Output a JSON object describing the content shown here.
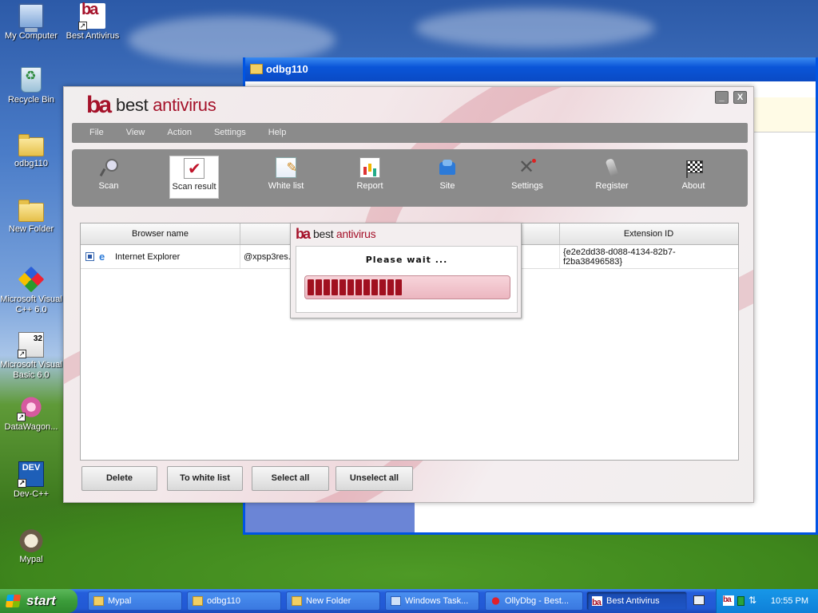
{
  "desktop": {
    "icons": [
      {
        "label": "My Computer"
      },
      {
        "label": "Best Antivirus"
      },
      {
        "label": "Recycle Bin"
      },
      {
        "label": "odbg110"
      },
      {
        "label": "New Folder"
      },
      {
        "label": "Microsoft Visual C++ 6.0"
      },
      {
        "label": "Microsoft Visual Basic 6.0"
      },
      {
        "label": "DataWagon..."
      },
      {
        "label": "Dev-C++"
      },
      {
        "label": "Mypal"
      }
    ]
  },
  "bg_window": {
    "title": "odbg110"
  },
  "app": {
    "logo_mark": "ba",
    "logo_word1": "best",
    "logo_word2": " antivirus",
    "minimize": "_",
    "close": "X",
    "menu": [
      "File",
      "View",
      "Action",
      "Settings",
      "Help"
    ],
    "toolbar": [
      {
        "label": "Scan",
        "icon": "magnifier-icon"
      },
      {
        "label": "Scan result",
        "icon": "checklist-icon",
        "active": true
      },
      {
        "label": "White list",
        "icon": "notepad-icon"
      },
      {
        "label": "Report",
        "icon": "chart-report-icon"
      },
      {
        "label": "Site",
        "icon": "site-chair-icon"
      },
      {
        "label": "Settings",
        "icon": "tools-icon"
      },
      {
        "label": "Register",
        "icon": "key-icon"
      },
      {
        "label": "About",
        "icon": "checkered-flag-icon"
      }
    ],
    "table": {
      "columns": [
        "Browser name",
        "I",
        "",
        "Extension ID"
      ],
      "rows": [
        {
          "browser": "Internet Explorer",
          "col2": "@xpsp3res.c",
          "col3": "",
          "extension_id_1": "{e2e2dd38-d088-4134-82b7-",
          "extension_id_2": "f2ba38496583}"
        }
      ]
    },
    "buttons": {
      "delete": "Delete",
      "to_white_list": "To white list",
      "select_all": "Select all",
      "unselect_all": "Unselect all"
    }
  },
  "wait_dialog": {
    "logo_mark": "ba",
    "logo_word1": "best",
    "logo_word2": " antivirus",
    "message": "Please wait ...",
    "progress": 0.48
  },
  "taskbar": {
    "start": "start",
    "tasks": [
      {
        "label": "Mypal"
      },
      {
        "label": "odbg110"
      },
      {
        "label": "New Folder"
      },
      {
        "label": "Windows Task..."
      },
      {
        "label": "OllyDbg - Best..."
      },
      {
        "label": "Best Antivirus"
      }
    ],
    "clock": "10:55 PM"
  },
  "colors": {
    "brand": "#a5122a",
    "taskbar": "#245edb",
    "start": "#3b9c3a"
  }
}
